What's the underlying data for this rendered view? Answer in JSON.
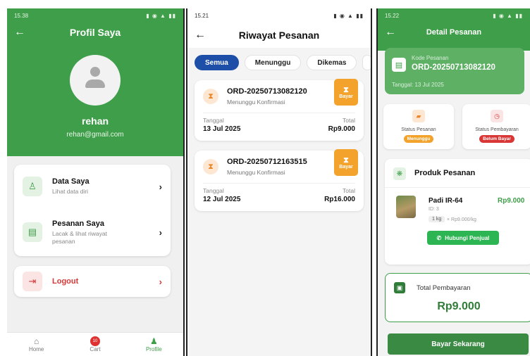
{
  "screen1": {
    "status_time": "15.38",
    "title": "Profil Saya",
    "user_name": "rehan",
    "user_email": "rehan@gmail.com",
    "menu": [
      {
        "title": "Data Saya",
        "subtitle": "Lihat data diri"
      },
      {
        "title": "Pesanan Saya",
        "subtitle": "Lacak & lihat riwayat pesanan"
      }
    ],
    "logout_label": "Logout",
    "nav": [
      {
        "label": "Home"
      },
      {
        "label": "Cart",
        "badge": "10"
      },
      {
        "label": "Profile"
      }
    ]
  },
  "screen2": {
    "status_time": "15.21",
    "title": "Riwayat Pesanan",
    "tabs": [
      "Semua",
      "Menunggu",
      "Dikemas"
    ],
    "orders": [
      {
        "id": "ORD-20250713082120",
        "status": "Menunggu Konfirmasi",
        "pay_label": "Bayar",
        "date_label": "Tanggal",
        "date": "13 Jul 2025",
        "total_label": "Total",
        "total": "Rp9.000"
      },
      {
        "id": "ORD-20250712163515",
        "status": "Menunggu Konfirmasi",
        "pay_label": "Bayar",
        "date_label": "Tanggal",
        "date": "12 Jul 2025",
        "total_label": "Total",
        "total": "Rp16.000"
      }
    ]
  },
  "screen3": {
    "status_time": "15.22",
    "title": "Detail Pesanan",
    "kode_label": "Kode Pesanan",
    "kode_value": "ORD-20250713082120",
    "date_text": "Tanggal: 13 Jul 2025",
    "status_pesanan_label": "Status Pesanan",
    "status_pesanan_badge": "Menunggu",
    "status_pembayaran_label": "Status Pembayaran",
    "status_pembayaran_badge": "Belum Bayar",
    "produk_title": "Produk Pesanan",
    "product_name": "Padi IR-64",
    "product_price": "Rp9.000",
    "product_id": "ID: 3",
    "product_qty": "1 kg",
    "product_unit": "× Rp9.000/kg",
    "contact_label": "Hubungi Penjual",
    "total_label": "Total Pembayaran",
    "total_value": "Rp9.000",
    "pay_button": "Bayar Sekarang"
  },
  "colors": {
    "primary_green": "#3f9e49",
    "blue_tab": "#1e4fa8",
    "orange": "#f3a22c",
    "red": "#d93636",
    "whatsapp_green": "#2db553"
  }
}
